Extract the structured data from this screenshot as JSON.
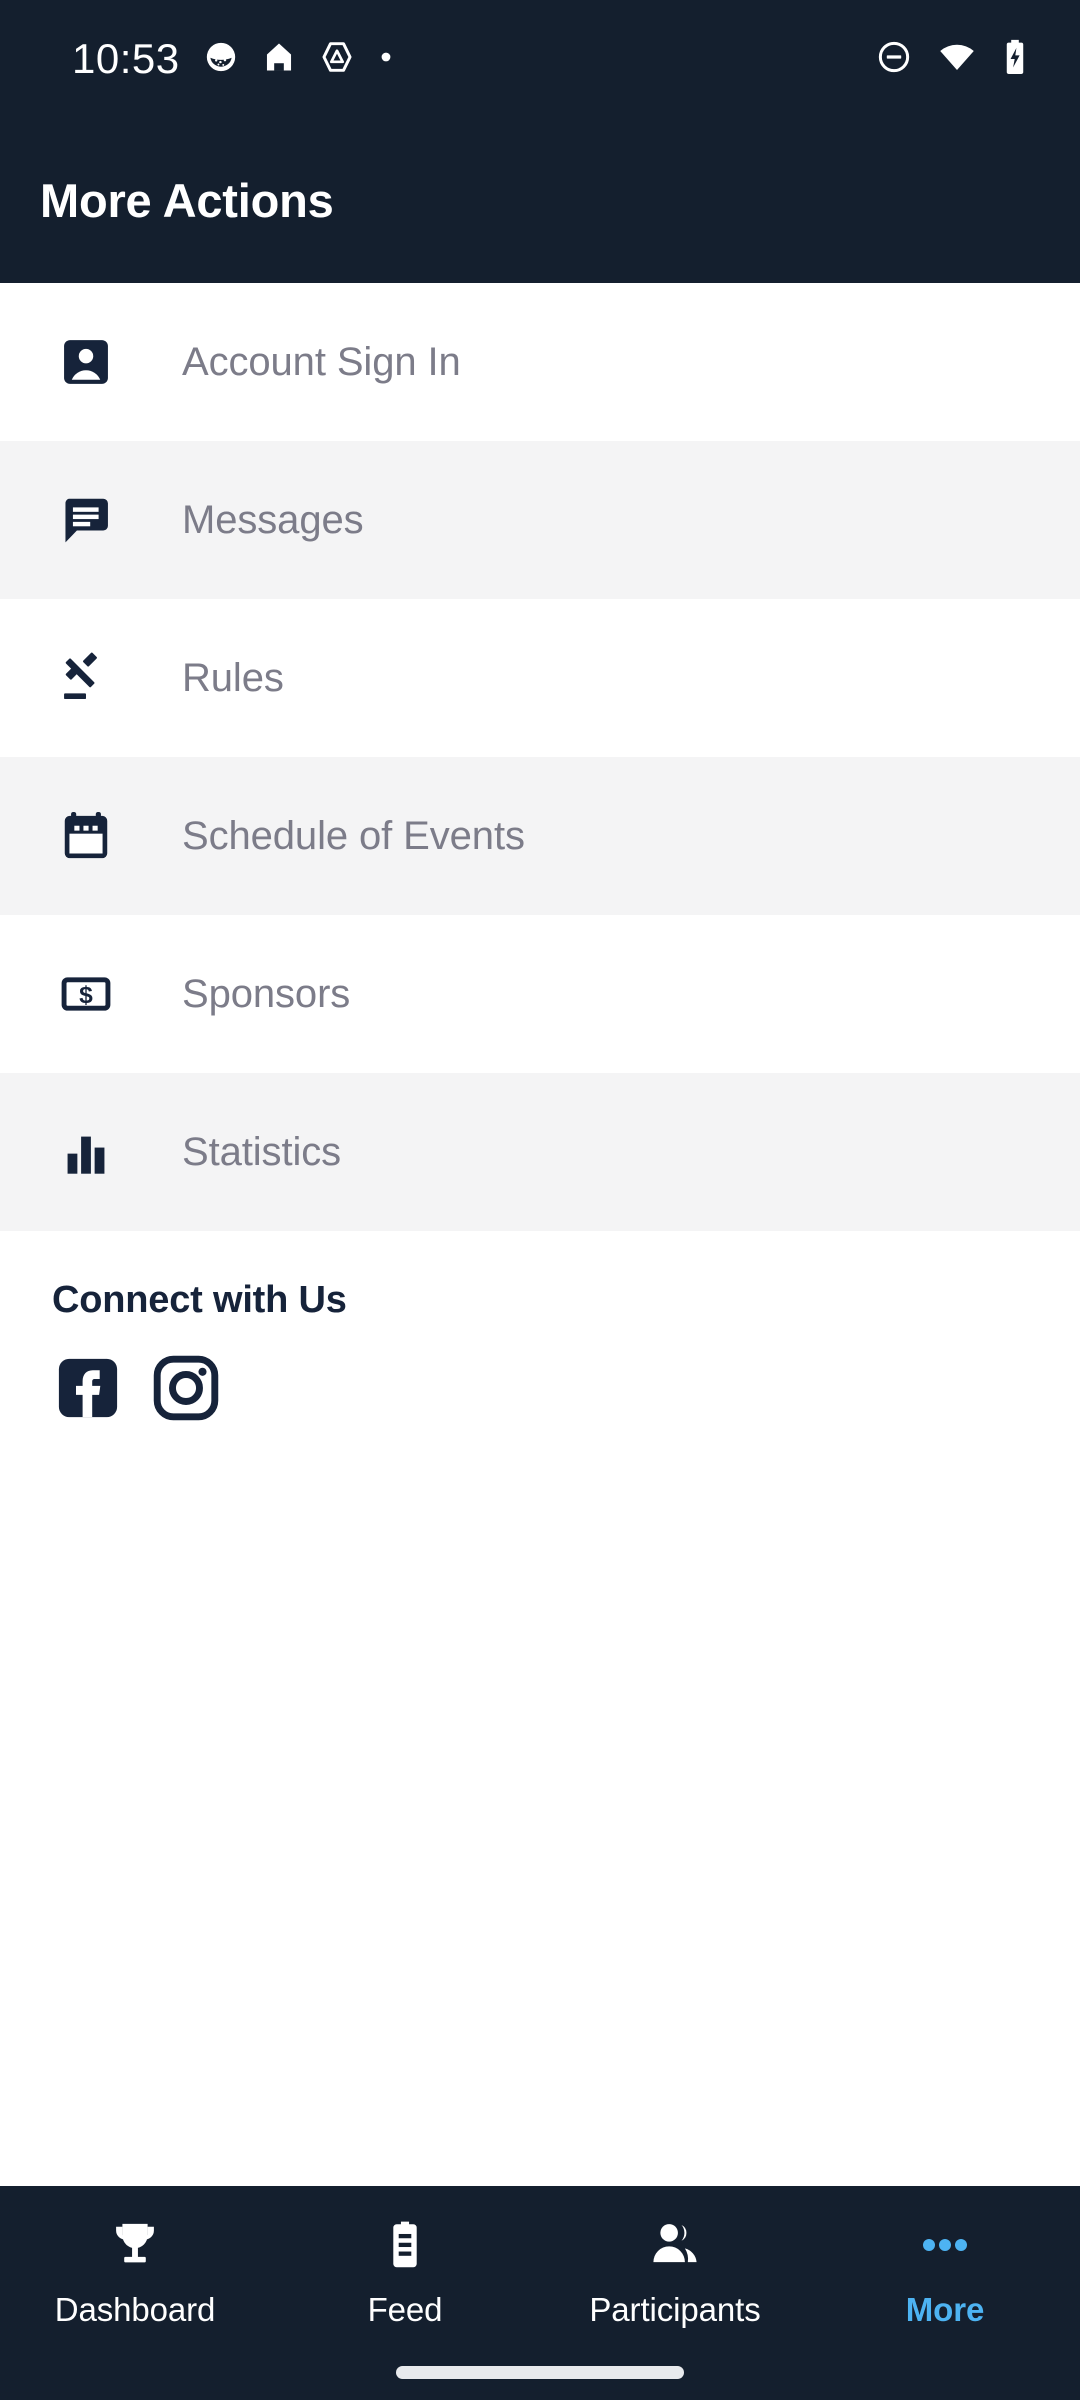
{
  "status_bar": {
    "time": "10:53",
    "left_icons": [
      "emoji-face-icon",
      "home-icon",
      "triangle-alert-icon",
      "dot-icon"
    ],
    "right_icons": [
      "do-not-disturb-icon",
      "wifi-icon",
      "battery-charging-icon"
    ],
    "background_color": "#141F2E"
  },
  "header": {
    "title": "More Actions",
    "background_color": "#141F2E",
    "text_color": "#FFFFFF"
  },
  "menu": {
    "row_background": "#FFFFFF",
    "row_background_alt": "#F4F4F5",
    "label_color": "#7C7C89",
    "icon_color": "#16233A",
    "items": [
      {
        "label": "Account Sign In",
        "icon": "account-box-icon"
      },
      {
        "label": "Messages",
        "icon": "chat-bubble-icon"
      },
      {
        "label": "Rules",
        "icon": "gavel-icon"
      },
      {
        "label": "Schedule of Events",
        "icon": "calendar-icon"
      },
      {
        "label": "Sponsors",
        "icon": "money-bill-icon"
      },
      {
        "label": "Statistics",
        "icon": "bar-chart-icon"
      }
    ]
  },
  "connect": {
    "title": "Connect with Us",
    "title_color": "#16233A",
    "socials": [
      {
        "name": "facebook",
        "icon": "facebook-icon"
      },
      {
        "name": "instagram",
        "icon": "instagram-icon"
      }
    ]
  },
  "bottom_nav": {
    "background_color": "#141F2E",
    "active_color": "#4DB3F2",
    "inactive_color": "#FFFFFF",
    "items": [
      {
        "label": "Dashboard",
        "icon": "trophy-icon",
        "active": false
      },
      {
        "label": "Feed",
        "icon": "clipboard-icon",
        "active": false
      },
      {
        "label": "Participants",
        "icon": "people-icon",
        "active": false
      },
      {
        "label": "More",
        "icon": "three-dots-icon",
        "active": true
      }
    ]
  }
}
